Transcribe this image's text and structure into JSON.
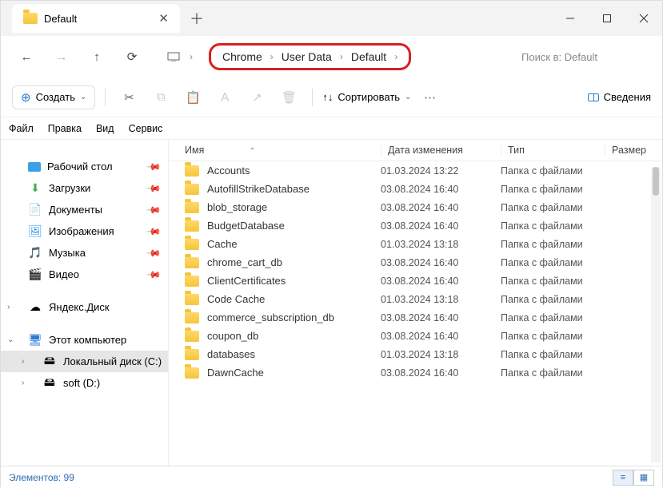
{
  "tab": {
    "title": "Default"
  },
  "breadcrumb": [
    "Chrome",
    "User Data",
    "Default"
  ],
  "search": {
    "placeholder": "Поиск в: Default"
  },
  "toolbar": {
    "create": "Создать",
    "sort": "Сортировать",
    "details": "Сведения"
  },
  "menubar": [
    "Файл",
    "Правка",
    "Вид",
    "Сервис"
  ],
  "columns": {
    "name": "Имя",
    "date": "Дата изменения",
    "type": "Тип",
    "size": "Размер"
  },
  "sidebar": {
    "quick": [
      {
        "label": "Рабочий стол",
        "icon": "desktop"
      },
      {
        "label": "Загрузки",
        "icon": "download"
      },
      {
        "label": "Документы",
        "icon": "doc"
      },
      {
        "label": "Изображения",
        "icon": "image"
      },
      {
        "label": "Музыка",
        "icon": "music"
      },
      {
        "label": "Видео",
        "icon": "video"
      }
    ],
    "yandex": "Яндекс.Диск",
    "thispc": "Этот компьютер",
    "drives": [
      {
        "label": "Локальный диск (C:)"
      },
      {
        "label": "soft (D:)"
      }
    ]
  },
  "files": [
    {
      "name": "Accounts",
      "date": "01.03.2024 13:22",
      "type": "Папка с файлами"
    },
    {
      "name": "AutofillStrikeDatabase",
      "date": "03.08.2024 16:40",
      "type": "Папка с файлами"
    },
    {
      "name": "blob_storage",
      "date": "03.08.2024 16:40",
      "type": "Папка с файлами"
    },
    {
      "name": "BudgetDatabase",
      "date": "03.08.2024 16:40",
      "type": "Папка с файлами"
    },
    {
      "name": "Cache",
      "date": "01.03.2024 13:18",
      "type": "Папка с файлами"
    },
    {
      "name": "chrome_cart_db",
      "date": "03.08.2024 16:40",
      "type": "Папка с файлами"
    },
    {
      "name": "ClientCertificates",
      "date": "03.08.2024 16:40",
      "type": "Папка с файлами"
    },
    {
      "name": "Code Cache",
      "date": "01.03.2024 13:18",
      "type": "Папка с файлами"
    },
    {
      "name": "commerce_subscription_db",
      "date": "03.08.2024 16:40",
      "type": "Папка с файлами"
    },
    {
      "name": "coupon_db",
      "date": "03.08.2024 16:40",
      "type": "Папка с файлами"
    },
    {
      "name": "databases",
      "date": "01.03.2024 13:18",
      "type": "Папка с файлами"
    },
    {
      "name": "DawnCache",
      "date": "03.08.2024 16:40",
      "type": "Папка с файлами"
    }
  ],
  "status": {
    "count_label": "Элементов:",
    "count": "99"
  }
}
